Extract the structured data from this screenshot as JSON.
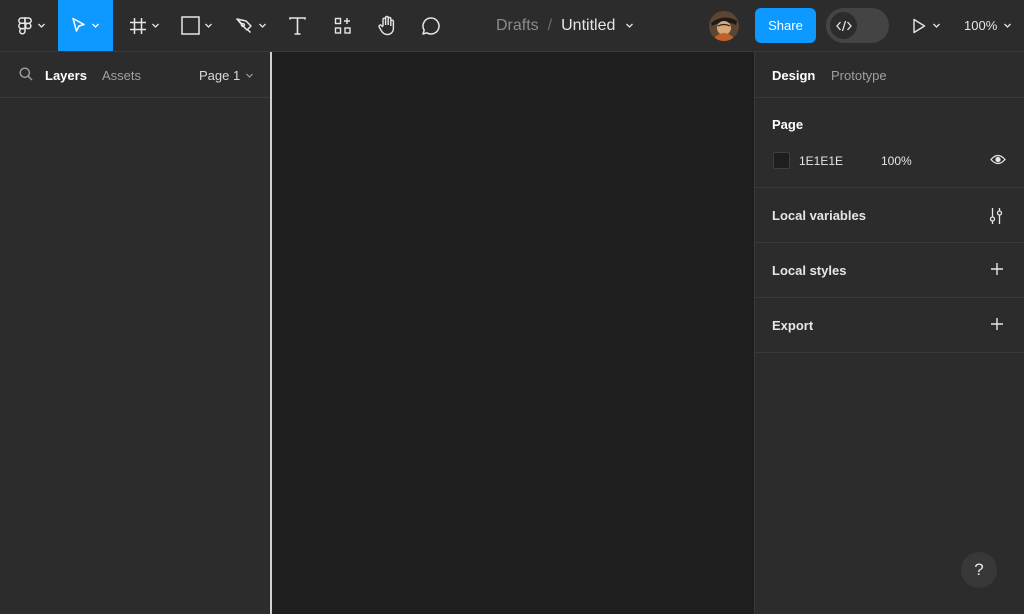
{
  "toolbar": {
    "breadcrumb": "Drafts",
    "separator": "/",
    "file_name": "Untitled",
    "share_label": "Share",
    "zoom": "100%"
  },
  "left_panel": {
    "tab_layers": "Layers",
    "tab_assets": "Assets",
    "page_selector": "Page 1"
  },
  "right_panel": {
    "tab_design": "Design",
    "tab_prototype": "Prototype",
    "page_section": {
      "title": "Page",
      "fill_hex": "1E1E1E",
      "fill_opacity": "100%"
    },
    "sections": {
      "local_variables": "Local variables",
      "local_styles": "Local styles",
      "export": "Export"
    }
  },
  "help_label": "?",
  "colors": {
    "accent": "#0d99ff",
    "canvas": "#1e1e1e",
    "panel": "#2c2c2c"
  }
}
